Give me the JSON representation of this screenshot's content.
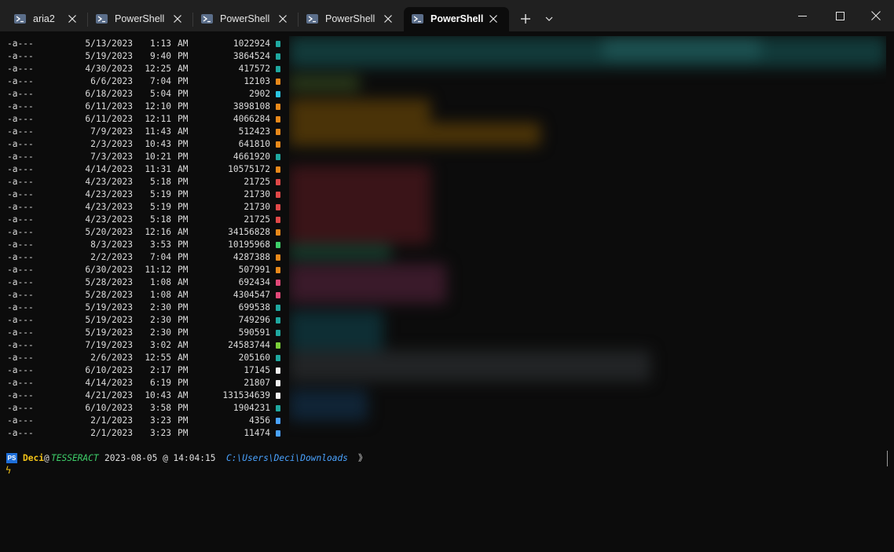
{
  "tabs": [
    {
      "label": "aria2",
      "active": false
    },
    {
      "label": "PowerShell",
      "active": false
    },
    {
      "label": "PowerShell",
      "active": false
    },
    {
      "label": "PowerShell",
      "active": false
    },
    {
      "label": "PowerShell",
      "active": true
    }
  ],
  "colors": {
    "icon_teal": "#1fa8a0",
    "icon_orange": "#e8891a",
    "icon_red": "#e04848",
    "icon_green": "#7bd03a",
    "icon_white": "#f0f0f0",
    "icon_blue": "#4aa3ff"
  },
  "files": [
    {
      "mode": "-a---",
      "date": "5/13/2023",
      "time": "1:13",
      "ampm": "AM",
      "size": "1022924",
      "icon": "file-teal-icon",
      "color": "#1fa8a0"
    },
    {
      "mode": "-a---",
      "date": "5/19/2023",
      "time": "9:40",
      "ampm": "PM",
      "size": "3864524",
      "icon": "file-teal-icon",
      "color": "#1fa8a0"
    },
    {
      "mode": "-a---",
      "date": "4/30/2023",
      "time": "12:25",
      "ampm": "AM",
      "size": "417572",
      "icon": "file-teal-icon",
      "color": "#1fa8a0"
    },
    {
      "mode": "-a---",
      "date": "6/6/2023",
      "time": "7:04",
      "ampm": "PM",
      "size": "12103",
      "icon": "file-orange-icon",
      "color": "#e8891a"
    },
    {
      "mode": "-a---",
      "date": "6/18/2023",
      "time": "5:04",
      "ampm": "PM",
      "size": "2902",
      "icon": "file-cyan-icon",
      "color": "#2bc4e0"
    },
    {
      "mode": "-a---",
      "date": "6/11/2023",
      "time": "12:10",
      "ampm": "PM",
      "size": "3898108",
      "icon": "file-orange-icon",
      "color": "#e8891a"
    },
    {
      "mode": "-a---",
      "date": "6/11/2023",
      "time": "12:11",
      "ampm": "PM",
      "size": "4066284",
      "icon": "file-orange-icon",
      "color": "#e8891a"
    },
    {
      "mode": "-a---",
      "date": "7/9/2023",
      "time": "11:43",
      "ampm": "AM",
      "size": "512423",
      "icon": "file-orange-icon",
      "color": "#e8891a"
    },
    {
      "mode": "-a---",
      "date": "2/3/2023",
      "time": "10:43",
      "ampm": "PM",
      "size": "641810",
      "icon": "file-orange-icon",
      "color": "#e8891a"
    },
    {
      "mode": "-a---",
      "date": "7/3/2023",
      "time": "10:21",
      "ampm": "PM",
      "size": "4661920",
      "icon": "file-teal-icon",
      "color": "#1fa8a0"
    },
    {
      "mode": "-a---",
      "date": "4/14/2023",
      "time": "11:31",
      "ampm": "AM",
      "size": "10575172",
      "icon": "file-orange-icon",
      "color": "#e8891a"
    },
    {
      "mode": "-a---",
      "date": "4/23/2023",
      "time": "5:18",
      "ampm": "PM",
      "size": "21725",
      "icon": "pdf-red-icon",
      "color": "#e04848"
    },
    {
      "mode": "-a---",
      "date": "4/23/2023",
      "time": "5:19",
      "ampm": "PM",
      "size": "21730",
      "icon": "pdf-red-icon",
      "color": "#e04848"
    },
    {
      "mode": "-a---",
      "date": "4/23/2023",
      "time": "5:19",
      "ampm": "PM",
      "size": "21730",
      "icon": "pdf-red-icon",
      "color": "#e04848"
    },
    {
      "mode": "-a---",
      "date": "4/23/2023",
      "time": "5:18",
      "ampm": "PM",
      "size": "21725",
      "icon": "pdf-red-icon",
      "color": "#e04848"
    },
    {
      "mode": "-a---",
      "date": "5/20/2023",
      "time": "12:16",
      "ampm": "AM",
      "size": "34156828",
      "icon": "file-orange-icon",
      "color": "#e8891a"
    },
    {
      "mode": "-a---",
      "date": "8/3/2023",
      "time": "3:53",
      "ampm": "PM",
      "size": "10195968",
      "icon": "installer-green-icon",
      "color": "#3ecf6a"
    },
    {
      "mode": "-a---",
      "date": "2/2/2023",
      "time": "7:04",
      "ampm": "PM",
      "size": "4287388",
      "icon": "file-orange-icon",
      "color": "#e8891a"
    },
    {
      "mode": "-a---",
      "date": "6/30/2023",
      "time": "11:12",
      "ampm": "PM",
      "size": "507991",
      "icon": "file-orange-icon",
      "color": "#e8891a"
    },
    {
      "mode": "-a---",
      "date": "5/28/2023",
      "time": "1:08",
      "ampm": "AM",
      "size": "692434",
      "icon": "file-pink-icon",
      "color": "#e04878"
    },
    {
      "mode": "-a---",
      "date": "5/28/2023",
      "time": "1:08",
      "ampm": "AM",
      "size": "4304547",
      "icon": "file-pink-icon",
      "color": "#e04878"
    },
    {
      "mode": "-a---",
      "date": "5/19/2023",
      "time": "2:30",
      "ampm": "PM",
      "size": "699538",
      "icon": "file-teal-icon",
      "color": "#1fa8a0"
    },
    {
      "mode": "-a---",
      "date": "5/19/2023",
      "time": "2:30",
      "ampm": "PM",
      "size": "749296",
      "icon": "file-teal-icon",
      "color": "#1fa8a0"
    },
    {
      "mode": "-a---",
      "date": "5/19/2023",
      "time": "2:30",
      "ampm": "PM",
      "size": "590591",
      "icon": "file-teal-icon",
      "color": "#1fa8a0"
    },
    {
      "mode": "-a---",
      "date": "7/19/2023",
      "time": "3:02",
      "ampm": "AM",
      "size": "24583744",
      "icon": "file-green-icon",
      "color": "#7bd03a"
    },
    {
      "mode": "-a---",
      "date": "2/6/2023",
      "time": "12:55",
      "ampm": "AM",
      "size": "205160",
      "icon": "file-teal-icon",
      "color": "#1fa8a0"
    },
    {
      "mode": "-a---",
      "date": "6/10/2023",
      "time": "2:17",
      "ampm": "PM",
      "size": "17145",
      "icon": "file-white-icon",
      "color": "#f0f0f0"
    },
    {
      "mode": "-a---",
      "date": "4/14/2023",
      "time": "6:19",
      "ampm": "PM",
      "size": "21807",
      "icon": "file-white-icon",
      "color": "#f0f0f0"
    },
    {
      "mode": "-a---",
      "date": "4/21/2023",
      "time": "10:43",
      "ampm": "AM",
      "size": "131534639",
      "icon": "file-white-icon",
      "color": "#f0f0f0"
    },
    {
      "mode": "-a---",
      "date": "6/10/2023",
      "time": "3:58",
      "ampm": "PM",
      "size": "1904231",
      "icon": "file-teal-icon",
      "color": "#1fa8a0"
    },
    {
      "mode": "-a---",
      "date": "2/1/2023",
      "time": "3:23",
      "ampm": "PM",
      "size": "4356",
      "icon": "plus-blue-icon",
      "color": "#4aa3ff"
    },
    {
      "mode": "-a---",
      "date": "2/1/2023",
      "time": "3:23",
      "ampm": "PM",
      "size": "11474",
      "icon": "plus-blue-icon",
      "color": "#4aa3ff"
    }
  ],
  "prompt": {
    "badge": "PS",
    "user": "Deci",
    "at": "@",
    "host": "TESSERACT",
    "datetime": "2023-08-05 @ 14:04:15",
    "path": "C:\\Users\\Deci\\Downloads",
    "arrow": "》",
    "bolt": "ϟ"
  }
}
